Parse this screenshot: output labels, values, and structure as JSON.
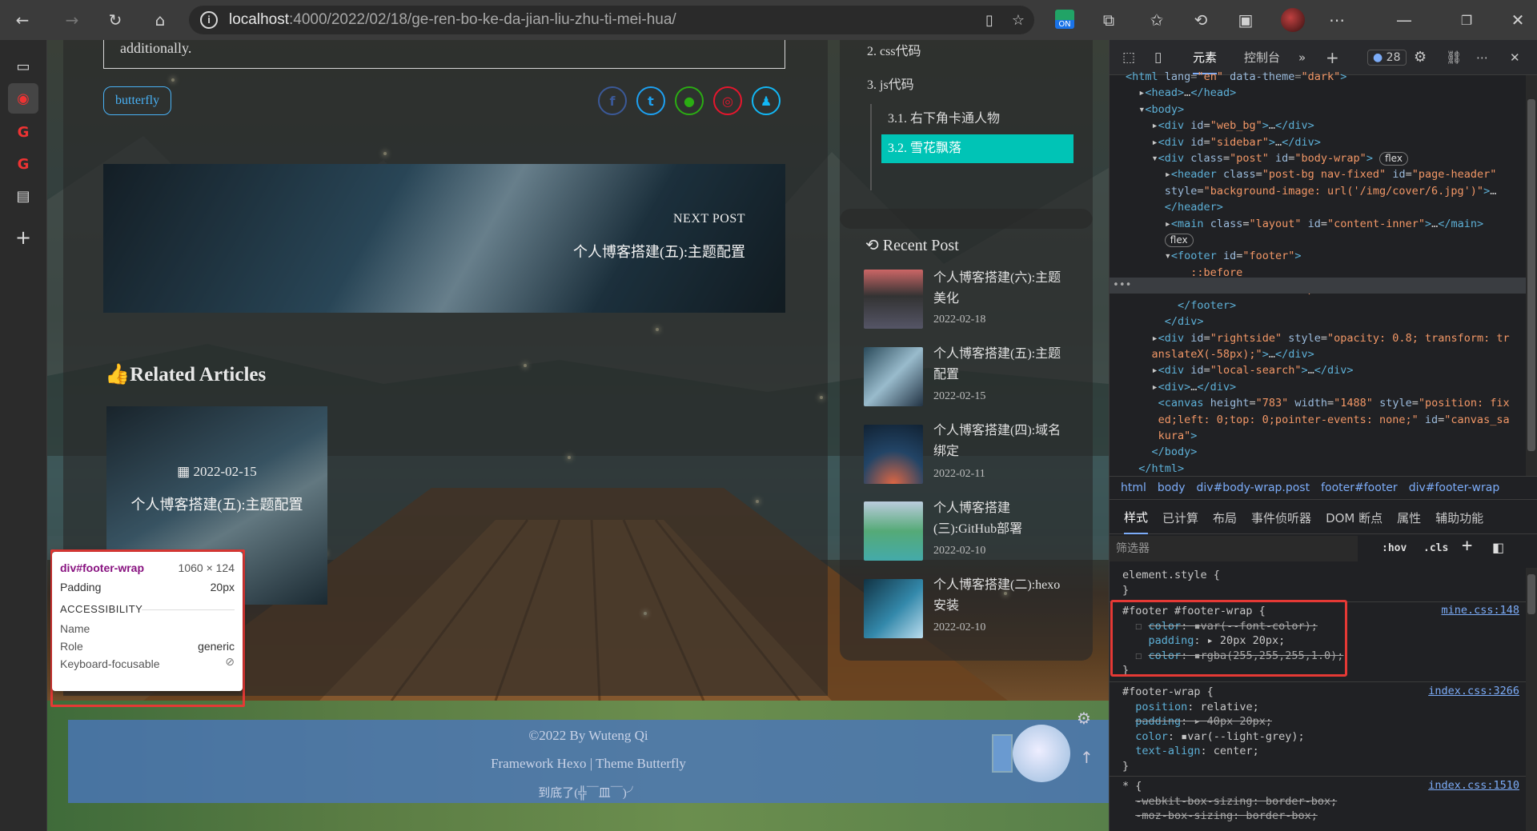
{
  "browser": {
    "url_host": "localhost",
    "url_path": ":4000/2022/02/18/ge-ren-bo-ke-da-jian-liu-zhu-ti-mei-hua/",
    "ext_badge": "ON"
  },
  "post": {
    "cut_text": "additionally.",
    "tag": "butterfly",
    "next_label": "NEXT POST",
    "next_title": "个人博客搭建(五):主题配置",
    "related_heading": "Related Articles",
    "related_date": "2022-02-15",
    "related_title": "个人博客搭建(五):主题配置"
  },
  "toc": {
    "items": [
      "2. css代码",
      "3. js代码",
      "3.1. 右下角卡通人物",
      "3.2. 雪花飘落"
    ]
  },
  "recent": {
    "heading": "Recent Post",
    "items": [
      {
        "title": "个人博客搭建(六):主题美化",
        "date": "2022-02-18"
      },
      {
        "title": "个人博客搭建(五):主题配置",
        "date": "2022-02-15"
      },
      {
        "title": "个人博客搭建(四):域名绑定",
        "date": "2022-02-11"
      },
      {
        "title": "个人博客搭建(三):GitHub部署",
        "date": "2022-02-10"
      },
      {
        "title": "个人博客搭建(二):hexo安装",
        "date": "2022-02-10"
      }
    ]
  },
  "footer": {
    "line1": "©2022 By Wuteng Qi",
    "line2": "Framework Hexo | Theme Butterfly",
    "line3": "到底了(╬￣皿￣)╯"
  },
  "tooltip": {
    "selector": "div#footer-wrap",
    "size": "1060 × 124",
    "padding_label": "Padding",
    "padding_value": "20px",
    "section": "ACCESSIBILITY",
    "name_label": "Name",
    "role_label": "Role",
    "role_value": "generic",
    "kbd_label": "Keyboard-focusable"
  },
  "devtools": {
    "tabs": {
      "elements": "元素",
      "console": "控制台",
      "issues": "28"
    },
    "breadcrumbs": [
      "html",
      "body",
      "div#body-wrap.post",
      "footer#footer",
      "div#footer-wrap"
    ],
    "style_tabs": [
      "样式",
      "已计算",
      "布局",
      "事件侦听器",
      "DOM 断点",
      "属性",
      "辅助功能"
    ],
    "filter": "筛选器",
    "hov": ":hov",
    "cls": ".cls",
    "sources": [
      "mine.css:148",
      "index.css:3266",
      "index.css:1510"
    ]
  },
  "colors": {
    "accent": "#00c4b6",
    "highlight": "#e53935"
  }
}
